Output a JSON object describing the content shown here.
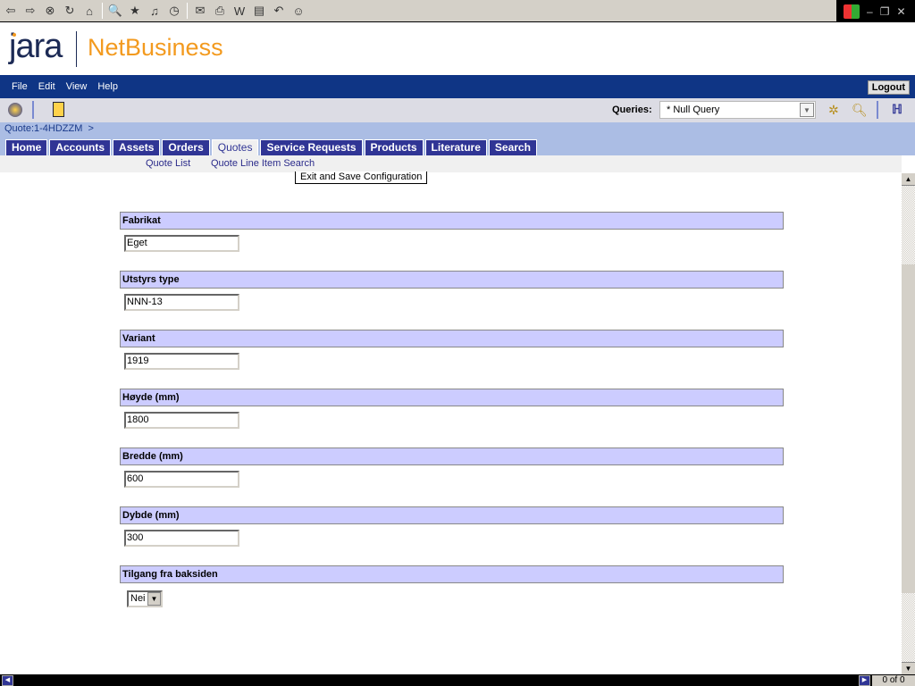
{
  "browser": {
    "icons": [
      "back-icon",
      "forward-icon",
      "stop-icon",
      "refresh-icon",
      "home-icon",
      "search-icon",
      "favorites-icon",
      "media-icon",
      "history-icon",
      "mail-icon",
      "print-icon",
      "edit-icon",
      "discuss-icon",
      "undo-icon",
      "messenger-icon"
    ]
  },
  "logo": {
    "brand": "jara",
    "product": "NetBusiness"
  },
  "menu": [
    "File",
    "Edit",
    "View",
    "Help"
  ],
  "logout": "Logout",
  "queries": {
    "label": "Queries:",
    "selected": "* Null Query"
  },
  "breadcrumb": "Quote:1-4HDZZM  >",
  "tabs": [
    {
      "label": "Home"
    },
    {
      "label": "Accounts"
    },
    {
      "label": "Assets"
    },
    {
      "label": "Orders"
    },
    {
      "label": "Quotes",
      "active": true
    },
    {
      "label": "Service Requests"
    },
    {
      "label": "Products"
    },
    {
      "label": "Literature"
    },
    {
      "label": "Search"
    }
  ],
  "subnav": [
    "Quote List",
    "Quote Line Item Search"
  ],
  "exit_button": "Exit and Save Configuration",
  "fields": [
    {
      "label": "Fabrikat",
      "value": "Eget"
    },
    {
      "label": "Utstyrs type",
      "value": "NNN-13"
    },
    {
      "label": "Variant",
      "value": "1919"
    },
    {
      "label": "Høyde (mm)",
      "value": "1800"
    },
    {
      "label": "Bredde (mm)",
      "value": "600"
    },
    {
      "label": "Dybde (mm)",
      "value": "300"
    },
    {
      "label": "Tilgang fra baksiden",
      "value": "Nei"
    }
  ],
  "pager": "0 of 0",
  "colors": {
    "menubar": "#0f3585",
    "tab": "#303595",
    "section": "#ccccff",
    "accent": "#f39a1e"
  }
}
